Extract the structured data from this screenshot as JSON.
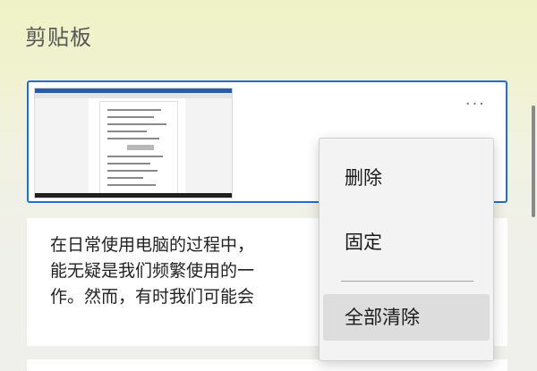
{
  "panel": {
    "title": "剪贴板"
  },
  "clipboard_items": [
    {
      "type": "image",
      "more_label": "···"
    },
    {
      "type": "text",
      "lines": [
        "在日常使用电脑的过程中，",
        "能无疑是我们频繁使用的一",
        "作。然而，有时我们可能会"
      ]
    }
  ],
  "context_menu": {
    "items": [
      {
        "label": "删除"
      },
      {
        "label": "固定"
      },
      {
        "label": "全部清除"
      }
    ]
  },
  "colors": {
    "accent": "#1f6fd0",
    "background_top": "#eff2c6",
    "menu_background": "#f3f3f3",
    "menu_hover": "#dddddd"
  }
}
